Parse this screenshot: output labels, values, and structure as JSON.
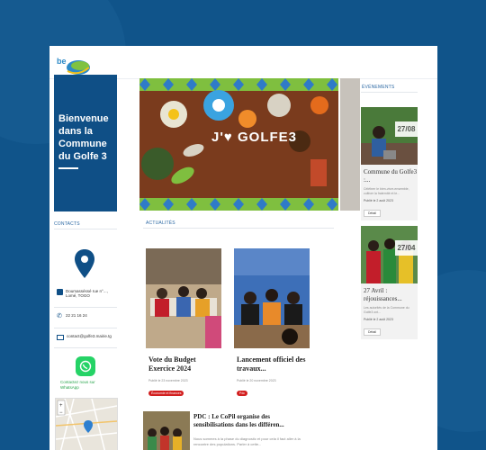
{
  "logo": {
    "text": "be"
  },
  "welcome": {
    "title": "Bienvenue\ndans la\nCommune\ndu Golfe 3"
  },
  "sections": {
    "contacts": "CONTACTS",
    "actualites": "ACTUALITÉS",
    "evenements": "ÉVÉNEMENTS"
  },
  "contacts": {
    "address": "Doumasséssé rue n°..., Lomé, TOGO",
    "phone": "22 21 16 24",
    "email": "contact@golfe3.mairie.tg",
    "whatsapp": "Contactez nous sur WhatsApp"
  },
  "banner": {
    "text": "J'♥ GOLFE3"
  },
  "news": [
    {
      "title": "Vote du Budget Exercice 2024",
      "meta": "Publié le 23 novembre 2023",
      "tag": "Économie et finances"
    },
    {
      "title": "Lancement officiel des travaux...",
      "meta": "Publié le 20 novembre 2023",
      "tag": "Pdc"
    }
  ],
  "wide_news": {
    "title": "PDC : Le CoPil organise des sensibilisations dans les différen...",
    "excerpt": "Nous sommes à la phase du diagnostic et pour cela il faut aller à la rencontre des populations. Parler à cette..."
  },
  "events": [
    {
      "date": "27/08",
      "title": "Commune du Golfe3 :...",
      "excerpt": "Célébrer le bien-vivre-ensemble, cultiver la fraternité et le...",
      "meta": "Publié le 2 août 2023",
      "button": "Détail"
    },
    {
      "date": "27/04",
      "title": "27 Avril : réjouissances...",
      "excerpt": "Les autorités de la Commune du Golfe3 ont...",
      "meta": "Publié le 2 août 2023",
      "button": "Détail"
    }
  ]
}
